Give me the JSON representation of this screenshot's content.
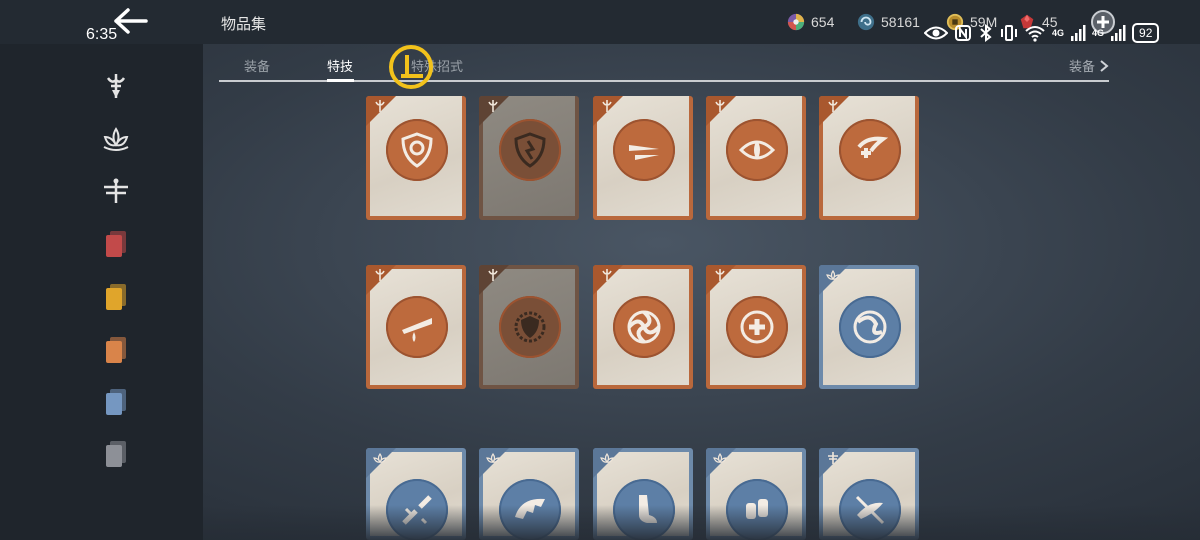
{
  "status_bar": {
    "time": "6:35",
    "battery": "92",
    "network_1": "4G",
    "network_2": "4G"
  },
  "header": {
    "title": "物品集"
  },
  "currencies": [
    {
      "icon": "colorful-wheel-icon",
      "value": "654"
    },
    {
      "icon": "blue-swirl-icon",
      "value": "58161"
    },
    {
      "icon": "gold-coin-icon",
      "value": "59M"
    },
    {
      "icon": "red-gem-icon",
      "value": "45"
    }
  ],
  "tabs": [
    {
      "label": "装备"
    },
    {
      "label": "特技"
    },
    {
      "label": "特殊招式"
    }
  ],
  "tab_right": {
    "label": "装备"
  },
  "sidebar": {
    "items": [
      {
        "name": "class-emblem-sword"
      },
      {
        "name": "class-emblem-lotus"
      },
      {
        "name": "class-emblem-dragonfly"
      },
      {
        "name": "card-red",
        "color": "#c24a4a"
      },
      {
        "name": "card-yellow",
        "color": "#e0a52b"
      },
      {
        "name": "card-orange",
        "color": "#d9844a"
      },
      {
        "name": "card-blue",
        "color": "#7597c1"
      },
      {
        "name": "card-gray",
        "color": "#8d9097"
      }
    ]
  },
  "colors": {
    "orange_card": "#b9683c",
    "blue_card": "#6d8aaa",
    "topbar": "#232a32",
    "sidebar": "#1f252c"
  },
  "cards": [
    {
      "icon": "shield-swirl-icon",
      "theme": "orange",
      "locked": false,
      "emblem": "sword"
    },
    {
      "icon": "broken-shield-icon",
      "theme": "orange",
      "locked": true,
      "emblem": "sword"
    },
    {
      "icon": "blades-icon",
      "theme": "orange",
      "locked": false,
      "emblem": "sword"
    },
    {
      "icon": "eye-icon",
      "theme": "orange",
      "locked": false,
      "emblem": "sword"
    },
    {
      "icon": "healing-hand-icon",
      "theme": "orange",
      "locked": false,
      "emblem": "sword"
    },
    {
      "icon": "dripping-blade-icon",
      "theme": "orange",
      "locked": false,
      "emblem": "sword"
    },
    {
      "icon": "spiked-shield-icon",
      "theme": "orange",
      "locked": true,
      "emblem": "sword"
    },
    {
      "icon": "swirl-orb-icon",
      "theme": "orange",
      "locked": false,
      "emblem": "sword"
    },
    {
      "icon": "swirl-cross-icon",
      "theme": "orange",
      "locked": false,
      "emblem": "sword"
    },
    {
      "icon": "blue-swirl-orb-icon",
      "theme": "blue",
      "locked": false,
      "emblem": "lotus"
    },
    {
      "icon": "broken-sword-icon",
      "theme": "blue",
      "locked": false,
      "emblem": "lotus"
    },
    {
      "icon": "beast-jaw-icon",
      "theme": "blue",
      "locked": false,
      "emblem": "lotus"
    },
    {
      "icon": "foot-icon",
      "theme": "blue",
      "locked": false,
      "emblem": "lotus"
    },
    {
      "icon": "fists-icon",
      "theme": "blue",
      "locked": false,
      "emblem": "lotus"
    },
    {
      "icon": "slashed-bird-icon",
      "theme": "blue",
      "locked": false,
      "emblem": "dragonfly"
    }
  ]
}
